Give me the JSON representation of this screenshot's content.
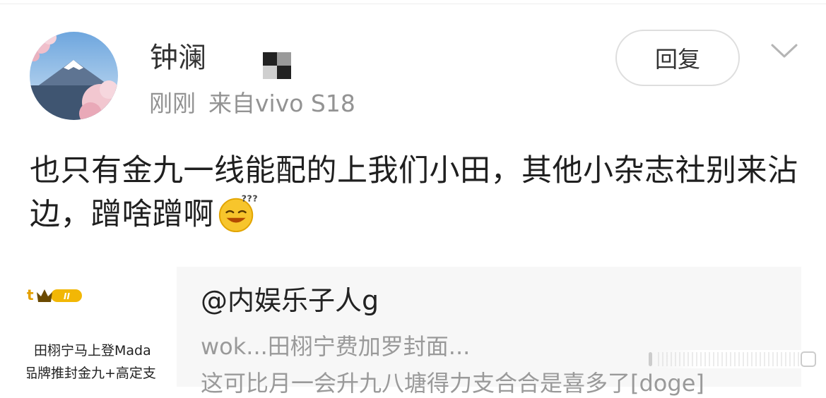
{
  "post": {
    "author": "钟澜",
    "time": "刚刚",
    "source": "来自vivo S18",
    "reply_label": "回复",
    "text": "也只有金九一线能配的上我们小田，其他小杂志社别来沾边，蹭啥蹭啊"
  },
  "quoted": {
    "author": "@内娱乐子人g",
    "line1": "wok...田栩宁费加罗封面...",
    "line2": "这可比月一会升九八塘得力支合合是喜多了[doge]",
    "thumb_badge": "t",
    "thumb_line1": "田栩宁马上登Mada",
    "thumb_line2": "品牌推封金九+高定支"
  },
  "icons": {
    "avatar": "avatar-mount-fuji",
    "menu": "chevron-down-icon",
    "emoji": "thinking-emoji-icon",
    "crown": "vip-crown-icon"
  },
  "colors": {
    "text": "#1f1f1f",
    "meta": "#939393",
    "card": "#f7f7f7"
  }
}
